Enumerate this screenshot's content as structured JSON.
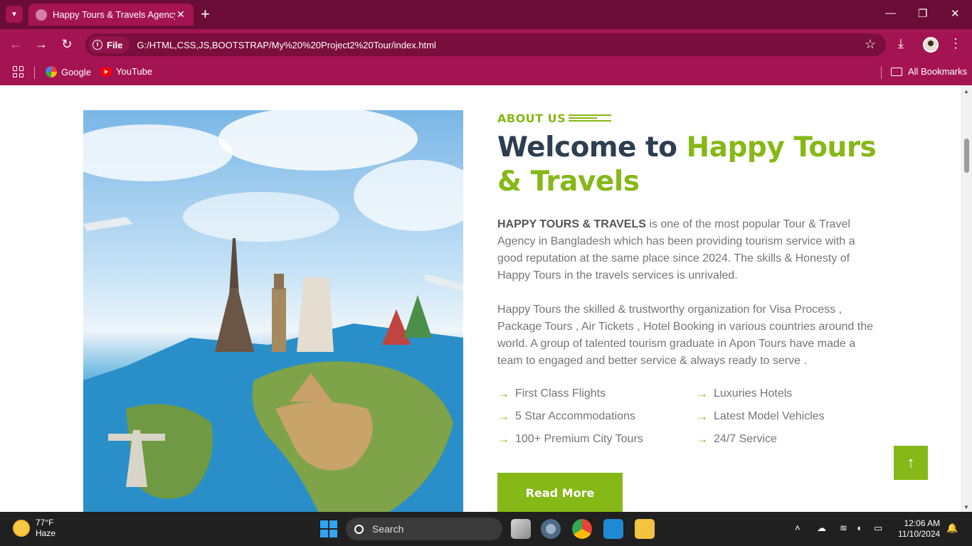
{
  "browser": {
    "tab_title": "Happy Tours & Travels Agency",
    "tab_close": "✕",
    "new_tab": "+",
    "site_chip": "File",
    "url": "G:/HTML,CSS,JS,BOOTSTRAP/My%20%20Project2%20Tour/index.html",
    "bookmarks": [
      {
        "label": "Google",
        "icon": "google-icon"
      },
      {
        "label": "YouTube",
        "icon": "youtube-icon"
      }
    ],
    "all_bookmarks": "All Bookmarks"
  },
  "page": {
    "about_label": "ABOUT US",
    "heading_prefix": "Welcome to ",
    "heading_highlight": "Happy Tours & Travels",
    "para1_bold": "HAPPY TOURS & TRAVELS",
    "para1_rest": " is one of the most popular Tour & Travel Agency in Bangladesh which has been providing tourism service with a good reputation at the same place since 2024. The skills & Honesty of Happy Tours in the travels services is unrivaled.",
    "para2": "Happy Tours the skilled & trustworthy organization for Visa Process , Package Tours , Air Tickets , Hotel Booking in various countries around the world. A group of talented tourism graduate in Apon Tours have made a team to engaged and better service & always ready to serve .",
    "features": [
      "First Class Flights",
      "Luxuries Hotels",
      "5 Star Accommodations",
      "Latest Model Vehicles",
      "100+ Premium City Tours",
      "24/7 Service"
    ],
    "read_more": "Read More",
    "accent_color": "#86b817"
  },
  "taskbar": {
    "temperature": "77°F",
    "weather": "Haze",
    "search_placeholder": "Search",
    "time": "12:06 AM",
    "date": "11/10/2024"
  }
}
